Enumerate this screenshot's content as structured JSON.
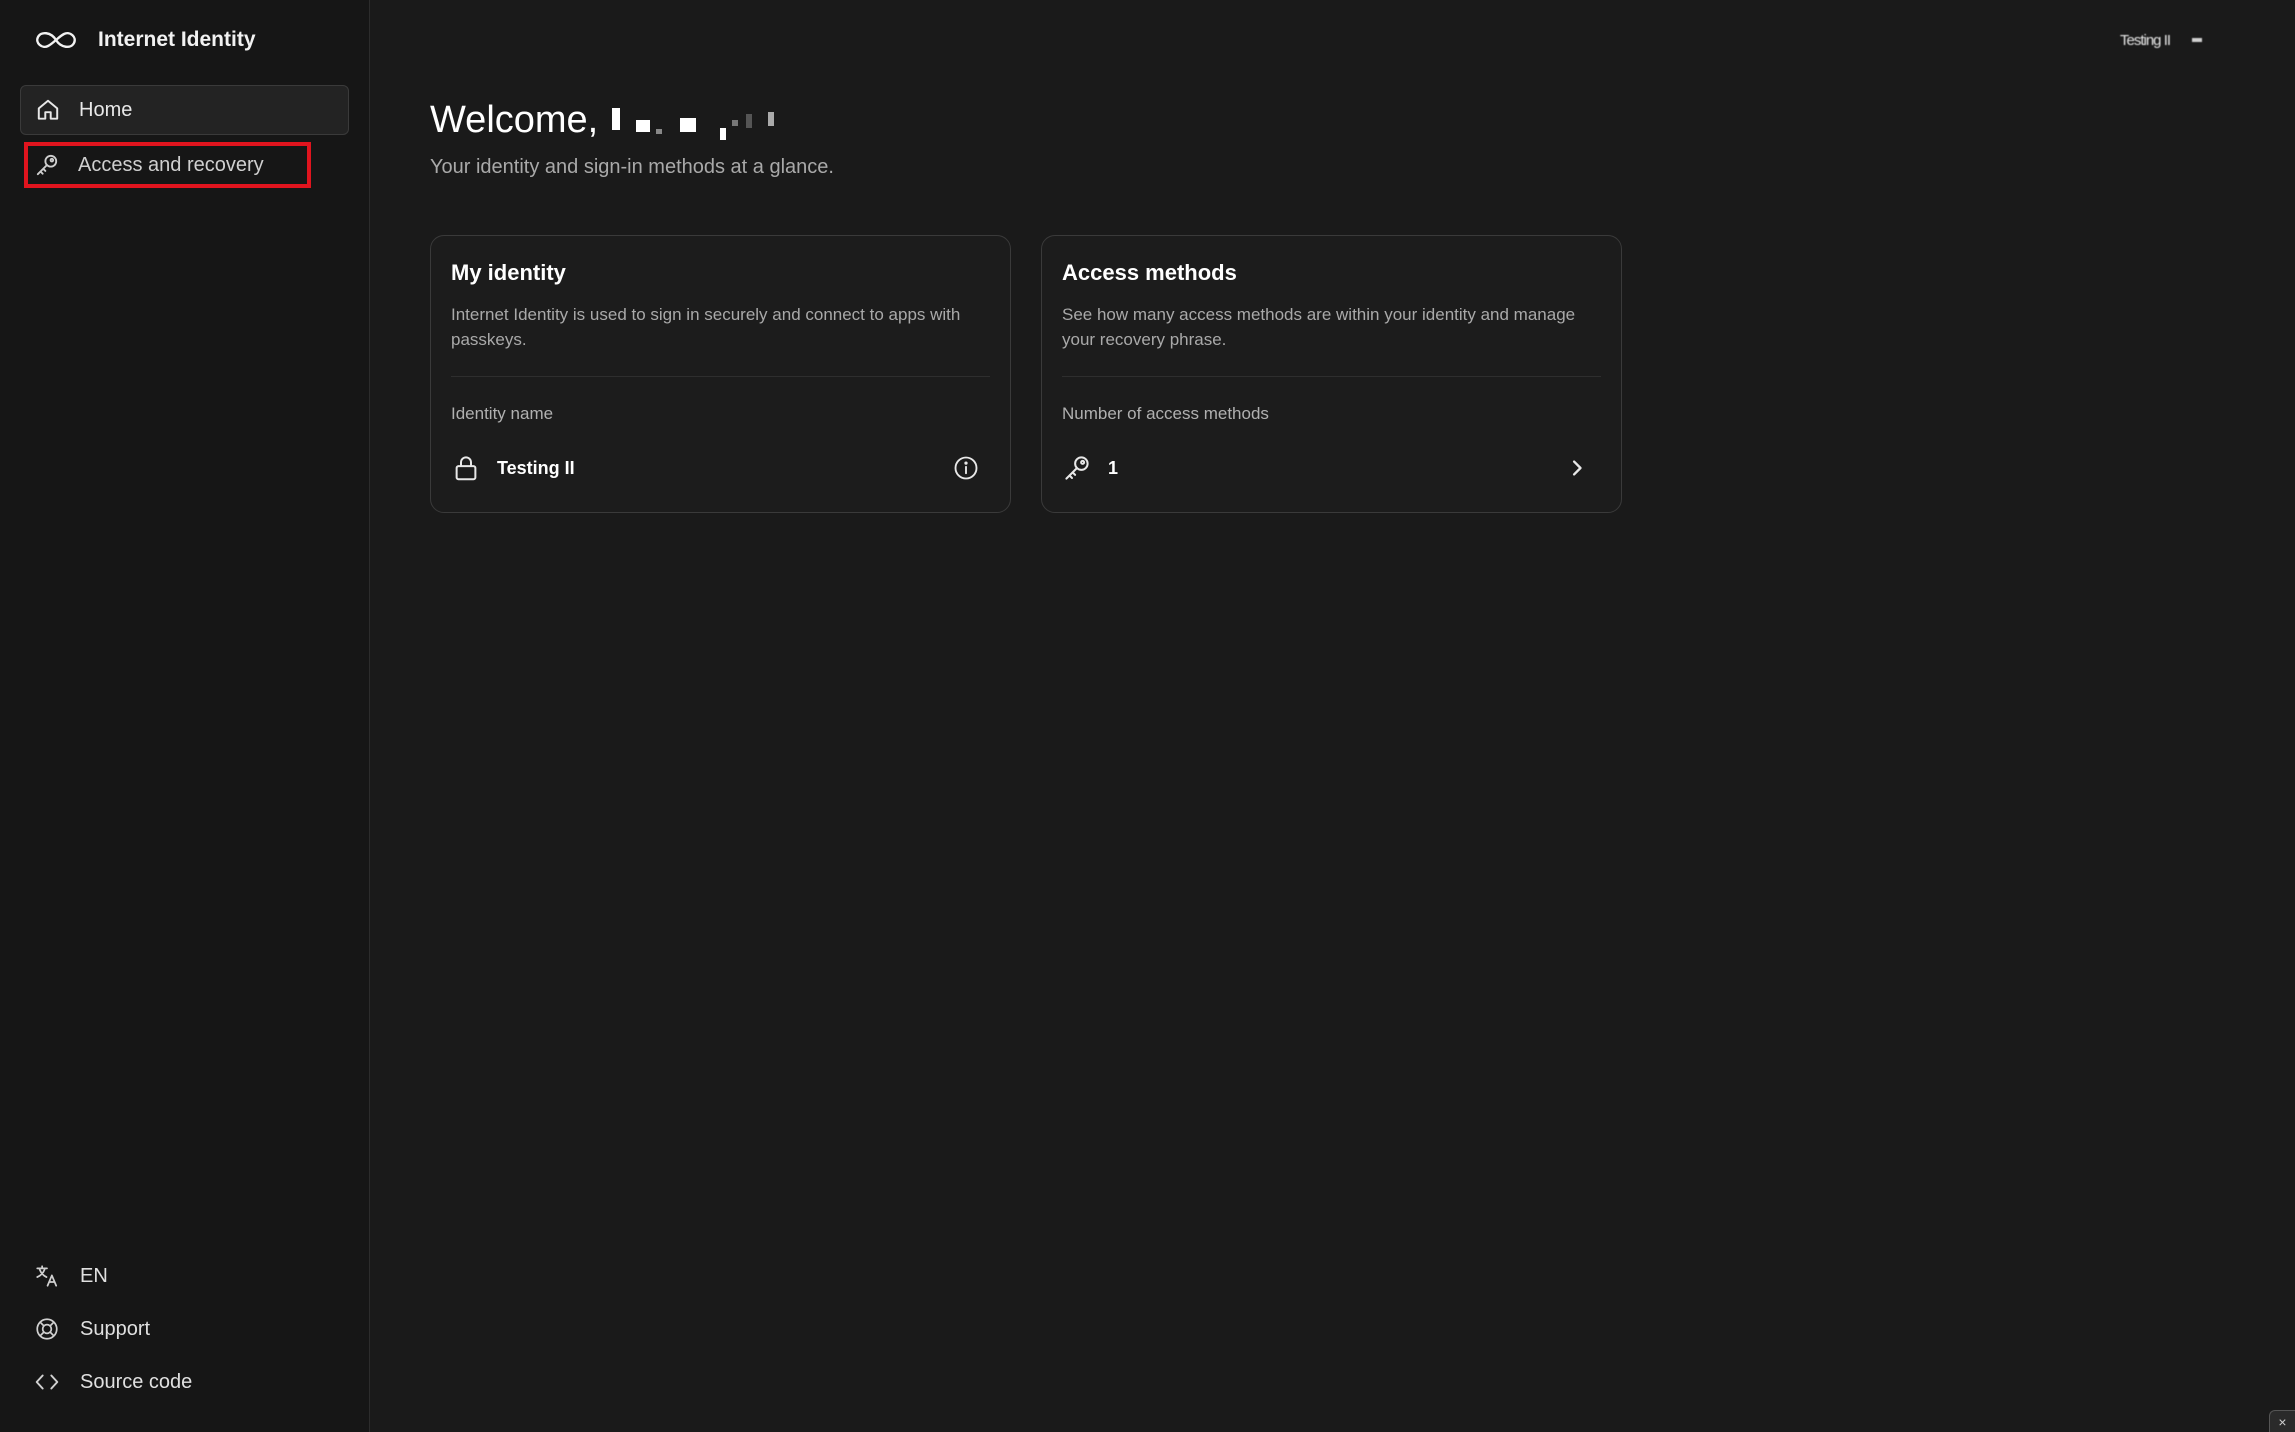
{
  "app": {
    "brand_name": "Internet Identity",
    "brand_icon": "infinity-logo-icon"
  },
  "sidebar": {
    "items": [
      {
        "label": "Home",
        "icon": "home-icon",
        "active": true
      },
      {
        "label": "Access and recovery",
        "icon": "key-icon",
        "active": false,
        "highlighted": true
      }
    ],
    "footer": [
      {
        "label": "EN",
        "icon": "language-icon"
      },
      {
        "label": "Support",
        "icon": "lifebuoy-icon"
      },
      {
        "label": "Source code",
        "icon": "code-icon"
      }
    ]
  },
  "header": {
    "user_name": "Testing II"
  },
  "main": {
    "welcome_prefix": "Welcome,",
    "subtitle": "Your identity and sign-in methods at a glance.",
    "cards": [
      {
        "title": "My identity",
        "description": "Internet Identity is used to sign in securely and connect to apps with passkeys.",
        "label": "Identity name",
        "value": "Testing II",
        "lead_icon": "lock-icon",
        "trail_icon": "info-icon"
      },
      {
        "title": "Access methods",
        "description": "See how many access methods are within your identity and manage your recovery phrase.",
        "label": "Number of access methods",
        "value": "1",
        "lead_icon": "key-icon",
        "trail_icon": "chevron-right-icon"
      }
    ]
  },
  "corner_button": {
    "label": "×"
  },
  "colors": {
    "background": "#1a1a1a",
    "sidebar": "#161616",
    "highlight": "#e0141e",
    "muted_text": "#a9a9a9"
  }
}
